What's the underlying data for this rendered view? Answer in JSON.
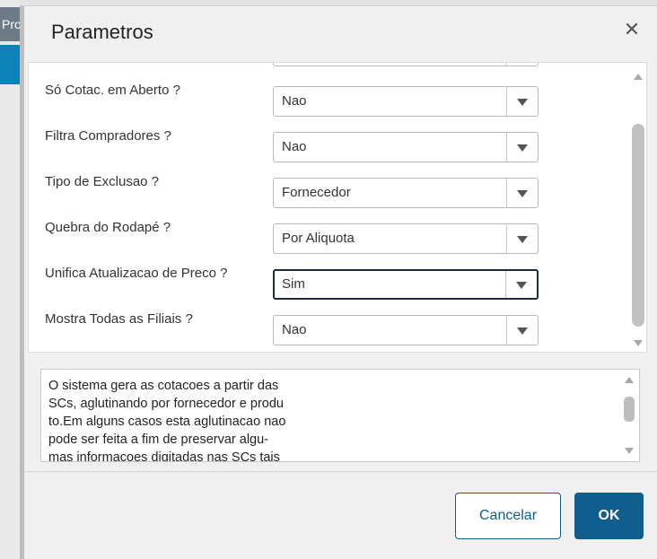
{
  "background": {
    "tab_label": "Pro"
  },
  "dialog": {
    "title": "Parametros",
    "close_icon": "close-icon"
  },
  "params": [
    {
      "label": "Só Cotac. em Aberto ?",
      "value": "Nao",
      "focused": false
    },
    {
      "label": "Filtra Compradores ?",
      "value": "Nao",
      "focused": false
    },
    {
      "label": "Tipo de Exclusao ?",
      "value": "Fornecedor",
      "focused": false
    },
    {
      "label": "Quebra do Rodapé ?",
      "value": "Por Aliquota",
      "focused": false
    },
    {
      "label": "Unifica Atualizacao de Preco ?",
      "value": "Sim",
      "focused": true
    },
    {
      "label": "Mostra Todas as Filiais ?",
      "value": "Nao",
      "focused": false
    }
  ],
  "help": {
    "text": "O sistema gera as cotacoes a partir das\nSCs, aglutinando por fornecedor e produ\nto.Em alguns casos esta aglutinacao nao\npode ser feita a fim de preservar algu-\nmas informacoes digitadas nas SCs tais"
  },
  "footer": {
    "cancel_label": "Cancelar",
    "ok_label": "OK"
  },
  "colors": {
    "primary": "#0f5e8e",
    "focus_border": "#1b2b3a",
    "app_blue": "#0c82b8"
  }
}
